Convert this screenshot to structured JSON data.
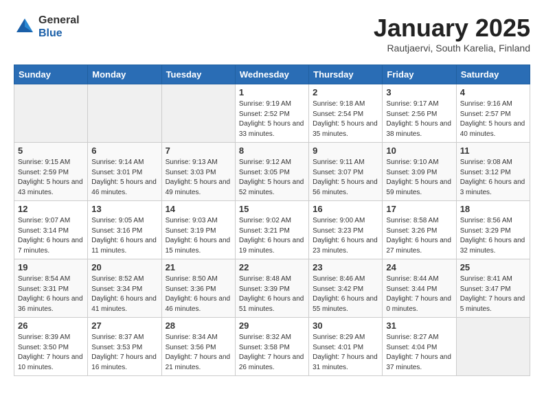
{
  "header": {
    "logo_general": "General",
    "logo_blue": "Blue",
    "title": "January 2025",
    "subtitle": "Rautjaervi, South Karelia, Finland"
  },
  "weekdays": [
    "Sunday",
    "Monday",
    "Tuesday",
    "Wednesday",
    "Thursday",
    "Friday",
    "Saturday"
  ],
  "weeks": [
    [
      {
        "day": "",
        "info": ""
      },
      {
        "day": "",
        "info": ""
      },
      {
        "day": "",
        "info": ""
      },
      {
        "day": "1",
        "info": "Sunrise: 9:19 AM\nSunset: 2:52 PM\nDaylight: 5 hours and 33 minutes."
      },
      {
        "day": "2",
        "info": "Sunrise: 9:18 AM\nSunset: 2:54 PM\nDaylight: 5 hours and 35 minutes."
      },
      {
        "day": "3",
        "info": "Sunrise: 9:17 AM\nSunset: 2:56 PM\nDaylight: 5 hours and 38 minutes."
      },
      {
        "day": "4",
        "info": "Sunrise: 9:16 AM\nSunset: 2:57 PM\nDaylight: 5 hours and 40 minutes."
      }
    ],
    [
      {
        "day": "5",
        "info": "Sunrise: 9:15 AM\nSunset: 2:59 PM\nDaylight: 5 hours and 43 minutes."
      },
      {
        "day": "6",
        "info": "Sunrise: 9:14 AM\nSunset: 3:01 PM\nDaylight: 5 hours and 46 minutes."
      },
      {
        "day": "7",
        "info": "Sunrise: 9:13 AM\nSunset: 3:03 PM\nDaylight: 5 hours and 49 minutes."
      },
      {
        "day": "8",
        "info": "Sunrise: 9:12 AM\nSunset: 3:05 PM\nDaylight: 5 hours and 52 minutes."
      },
      {
        "day": "9",
        "info": "Sunrise: 9:11 AM\nSunset: 3:07 PM\nDaylight: 5 hours and 56 minutes."
      },
      {
        "day": "10",
        "info": "Sunrise: 9:10 AM\nSunset: 3:09 PM\nDaylight: 5 hours and 59 minutes."
      },
      {
        "day": "11",
        "info": "Sunrise: 9:08 AM\nSunset: 3:12 PM\nDaylight: 6 hours and 3 minutes."
      }
    ],
    [
      {
        "day": "12",
        "info": "Sunrise: 9:07 AM\nSunset: 3:14 PM\nDaylight: 6 hours and 7 minutes."
      },
      {
        "day": "13",
        "info": "Sunrise: 9:05 AM\nSunset: 3:16 PM\nDaylight: 6 hours and 11 minutes."
      },
      {
        "day": "14",
        "info": "Sunrise: 9:03 AM\nSunset: 3:19 PM\nDaylight: 6 hours and 15 minutes."
      },
      {
        "day": "15",
        "info": "Sunrise: 9:02 AM\nSunset: 3:21 PM\nDaylight: 6 hours and 19 minutes."
      },
      {
        "day": "16",
        "info": "Sunrise: 9:00 AM\nSunset: 3:23 PM\nDaylight: 6 hours and 23 minutes."
      },
      {
        "day": "17",
        "info": "Sunrise: 8:58 AM\nSunset: 3:26 PM\nDaylight: 6 hours and 27 minutes."
      },
      {
        "day": "18",
        "info": "Sunrise: 8:56 AM\nSunset: 3:29 PM\nDaylight: 6 hours and 32 minutes."
      }
    ],
    [
      {
        "day": "19",
        "info": "Sunrise: 8:54 AM\nSunset: 3:31 PM\nDaylight: 6 hours and 36 minutes."
      },
      {
        "day": "20",
        "info": "Sunrise: 8:52 AM\nSunset: 3:34 PM\nDaylight: 6 hours and 41 minutes."
      },
      {
        "day": "21",
        "info": "Sunrise: 8:50 AM\nSunset: 3:36 PM\nDaylight: 6 hours and 46 minutes."
      },
      {
        "day": "22",
        "info": "Sunrise: 8:48 AM\nSunset: 3:39 PM\nDaylight: 6 hours and 51 minutes."
      },
      {
        "day": "23",
        "info": "Sunrise: 8:46 AM\nSunset: 3:42 PM\nDaylight: 6 hours and 55 minutes."
      },
      {
        "day": "24",
        "info": "Sunrise: 8:44 AM\nSunset: 3:44 PM\nDaylight: 7 hours and 0 minutes."
      },
      {
        "day": "25",
        "info": "Sunrise: 8:41 AM\nSunset: 3:47 PM\nDaylight: 7 hours and 5 minutes."
      }
    ],
    [
      {
        "day": "26",
        "info": "Sunrise: 8:39 AM\nSunset: 3:50 PM\nDaylight: 7 hours and 10 minutes."
      },
      {
        "day": "27",
        "info": "Sunrise: 8:37 AM\nSunset: 3:53 PM\nDaylight: 7 hours and 16 minutes."
      },
      {
        "day": "28",
        "info": "Sunrise: 8:34 AM\nSunset: 3:56 PM\nDaylight: 7 hours and 21 minutes."
      },
      {
        "day": "29",
        "info": "Sunrise: 8:32 AM\nSunset: 3:58 PM\nDaylight: 7 hours and 26 minutes."
      },
      {
        "day": "30",
        "info": "Sunrise: 8:29 AM\nSunset: 4:01 PM\nDaylight: 7 hours and 31 minutes."
      },
      {
        "day": "31",
        "info": "Sunrise: 8:27 AM\nSunset: 4:04 PM\nDaylight: 7 hours and 37 minutes."
      },
      {
        "day": "",
        "info": ""
      }
    ]
  ]
}
